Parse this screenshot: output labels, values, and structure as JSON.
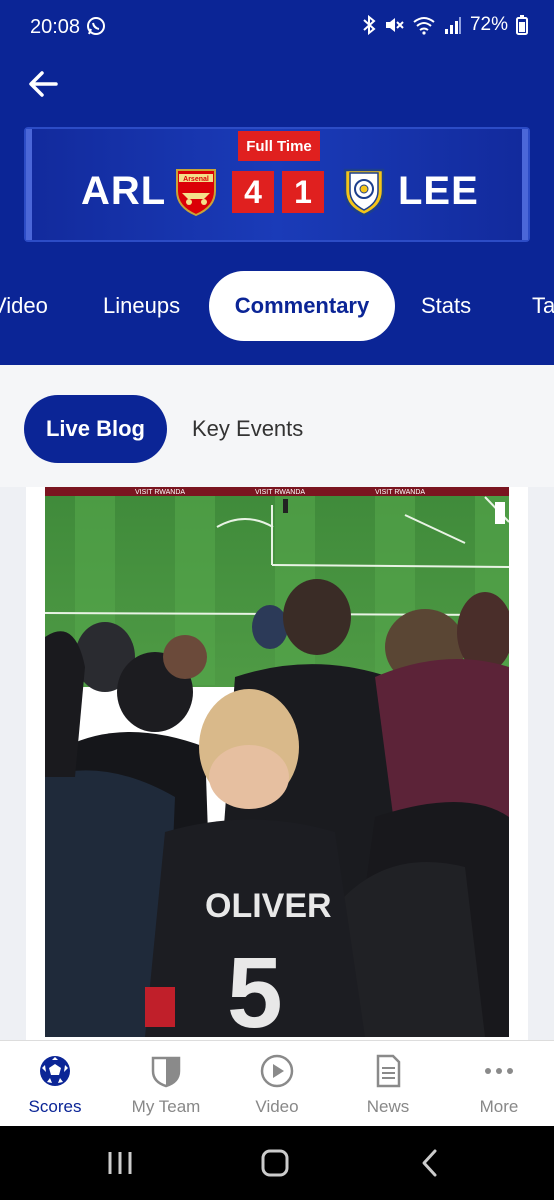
{
  "status_bar": {
    "time": "20:08",
    "battery": "72%"
  },
  "match": {
    "status": "Full Time",
    "home_team": "ARL",
    "away_team": "LEE",
    "home_score": "4",
    "away_score": "1",
    "home_crest_text": "Arsenal"
  },
  "tabs": [
    "Video",
    "Lineups",
    "Commentary",
    "Stats",
    "Ta"
  ],
  "active_tab": "Commentary",
  "subtabs": {
    "live_blog": "Live Blog",
    "key_events": "Key Events"
  },
  "photo": {
    "shirt_name": "OLIVER",
    "shirt_number": "5",
    "banner_text": "VISIT RWANDA"
  },
  "bottom_nav": [
    {
      "label": "Scores",
      "icon": "soccer-ball-icon"
    },
    {
      "label": "My Team",
      "icon": "shield-icon"
    },
    {
      "label": "Video",
      "icon": "play-circle-icon"
    },
    {
      "label": "News",
      "icon": "document-icon"
    },
    {
      "label": "More",
      "icon": "more-dots-icon"
    }
  ],
  "colors": {
    "brand_blue": "#0b2596",
    "score_red": "#e0201f"
  }
}
